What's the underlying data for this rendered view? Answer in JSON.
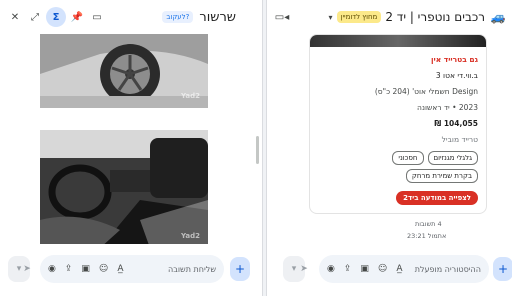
{
  "thread": {
    "title": "שרשור",
    "tag": "לעקוב?",
    "icons": [
      "close-icon",
      "expand-icon",
      "sigma-icon",
      "pin-icon",
      "folder-icon"
    ],
    "watermark": "Yad2",
    "composer_placeholder": "שליחת תשובה"
  },
  "channel": {
    "title": "רכבים נוטפרי | יד 2",
    "tag": "מחוץ לדומיין",
    "video_icon": "video-icon",
    "composer_placeholder": "ההיסטוריה מופעלת"
  },
  "listing": {
    "badge": "גם בטרייד אין",
    "model": "ב.ווי.די אטו 3",
    "trim": "Design חשמלי אוט' (204 כ\"ס)",
    "year_hand": "2023 • יד ראשונה",
    "price": "104,055 ₪",
    "dealer": "טרייד מוביל",
    "chips": [
      "גלגלי מגנזיום",
      "חסכוני",
      "בקרת שמירת מרחק"
    ],
    "cta": "לצפייה במודעה ביד2"
  },
  "meta": {
    "replies": "4 תשובות",
    "last_reply": "אתמול 23:21"
  },
  "colors": {
    "accent": "#0b57d0",
    "red": "#d93025",
    "yellow_tag": "#fce98a"
  }
}
